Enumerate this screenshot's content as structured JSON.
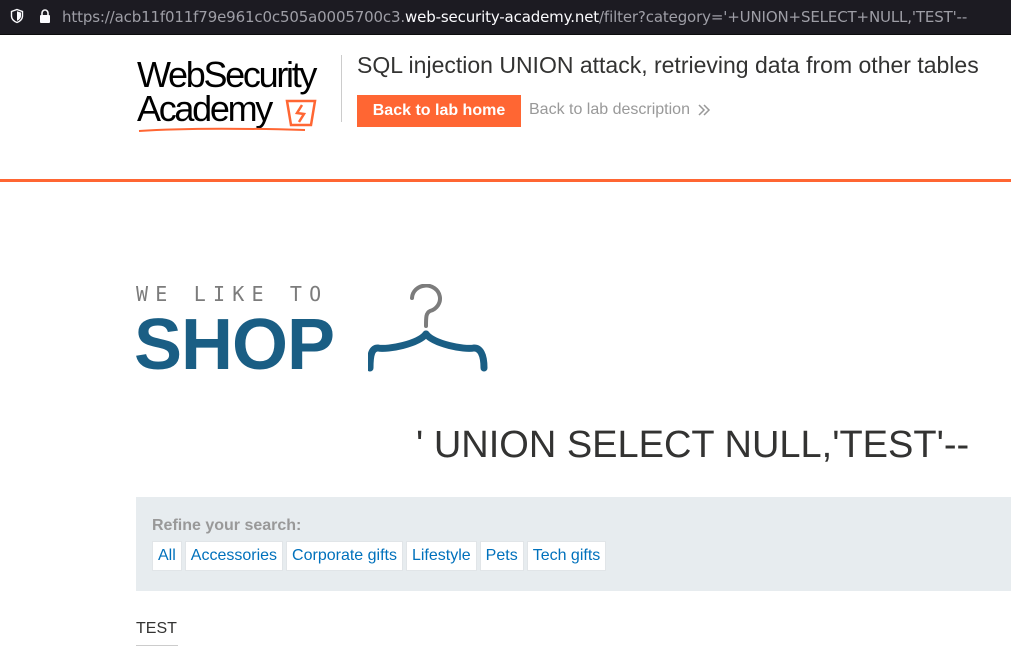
{
  "browser": {
    "url_prefix": "https://acb11f011f79e961c0c505a0005700c3.",
    "url_domain": "web-security-academy.net",
    "url_path": "/filter?category='+UNION+SELECT+NULL,'TEST'--"
  },
  "lab_header": {
    "logo_line1": "WebSecurity",
    "logo_line2": "Academy",
    "title": "SQL injection UNION attack, retrieving data from other tables",
    "back_home_label": "Back to lab home",
    "back_description_label": "Back to lab description"
  },
  "shop": {
    "tagline": "WE LIKE TO",
    "word": "SHOP"
  },
  "category_heading": "' UNION SELECT NULL,'TEST'--",
  "filter": {
    "label": "Refine your search:",
    "links": [
      "All",
      "Accessories",
      "Corporate gifts",
      "Lifestyle",
      "Pets",
      "Tech gifts"
    ]
  },
  "results": {
    "first_item": "TEST"
  },
  "colors": {
    "accent": "#ff6633",
    "brand_blue": "#1a5e84",
    "link_blue": "#0071bc"
  }
}
